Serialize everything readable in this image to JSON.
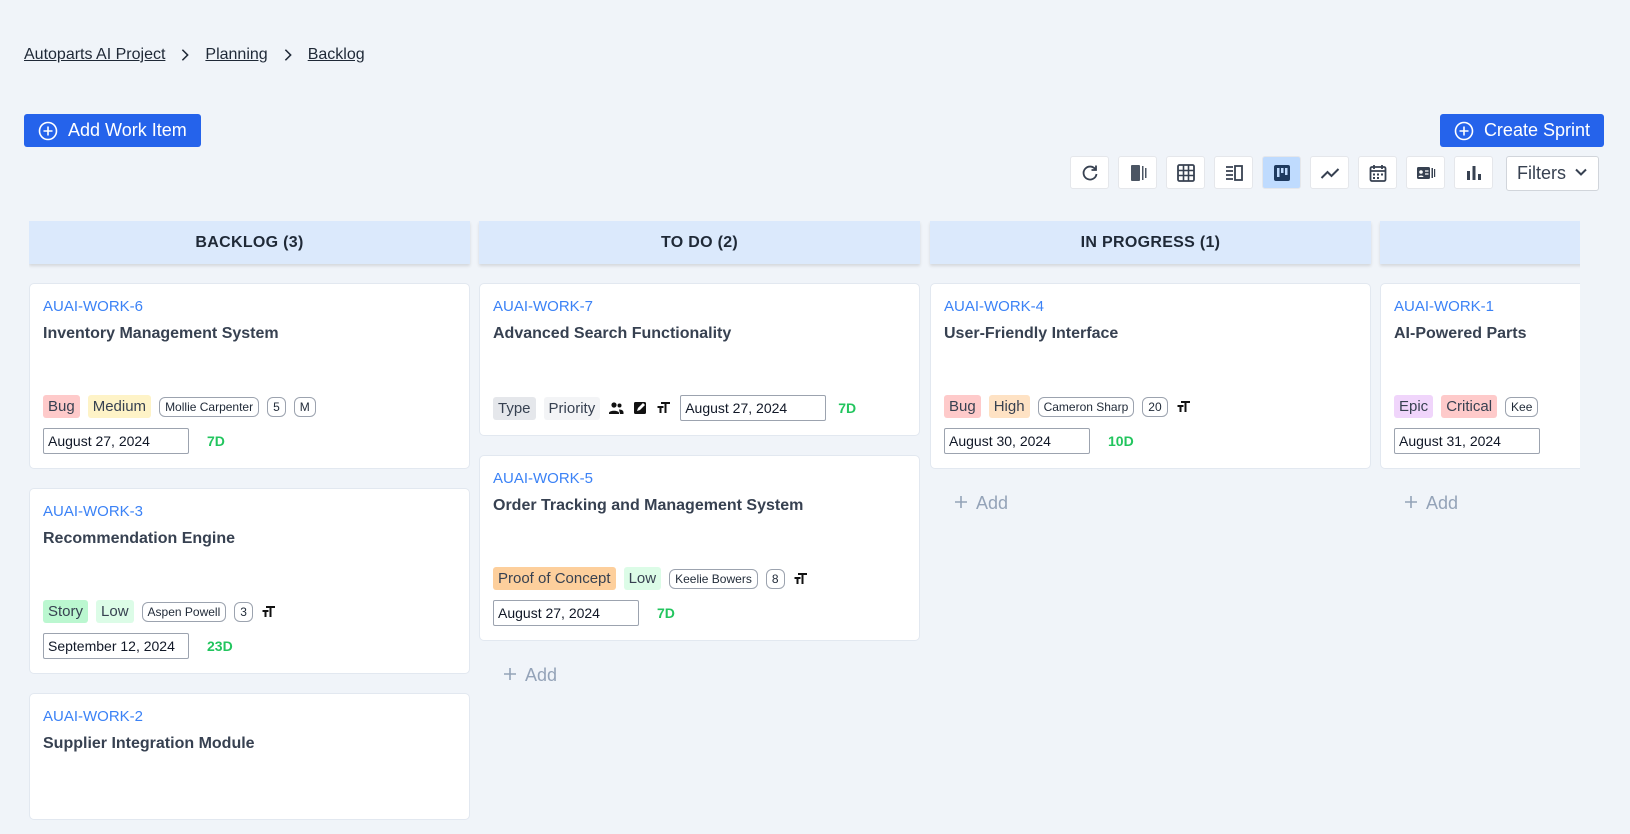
{
  "breadcrumb": [
    "Autoparts AI Project",
    "Planning",
    "Backlog"
  ],
  "actions": {
    "add_work_item": "Add Work Item",
    "create_sprint": "Create Sprint",
    "filters": "Filters",
    "add": "Add"
  },
  "toolbar_icons": [
    "refresh-icon",
    "sprint-view-icon",
    "grid-view-icon",
    "list-view-icon",
    "kanban-view-icon",
    "trend-view-icon",
    "calendar-view-icon",
    "card-view-icon",
    "chart-view-icon"
  ],
  "columns": [
    {
      "header": "BACKLOG (3)",
      "cards": [
        {
          "id": "AUAI-WORK-6",
          "title": "Inventory Management System",
          "type": "Bug",
          "priority": "Medium",
          "assignee": "Mollie Carpenter",
          "points": "5",
          "size": "M",
          "date": "August 27, 2024",
          "days": "7D"
        },
        {
          "id": "AUAI-WORK-3",
          "title": "Recommendation Engine",
          "type": "Story",
          "priority": "Low",
          "assignee": "Aspen Powell",
          "points": "3",
          "date": "September 12, 2024",
          "days": "23D"
        },
        {
          "id": "AUAI-WORK-2",
          "title": "Supplier Integration Module"
        }
      ]
    },
    {
      "header": "TO DO (2)",
      "cards": [
        {
          "id": "AUAI-WORK-7",
          "title": "Advanced Search Functionality",
          "type": "Type",
          "priority": "Priority",
          "date": "August 27, 2024",
          "days": "7D"
        },
        {
          "id": "AUAI-WORK-5",
          "title": "Order Tracking and Management System",
          "type": "Proof of Concept",
          "priority": "Low",
          "assignee": "Keelie Bowers",
          "points": "8",
          "date": "August 27, 2024",
          "days": "7D"
        }
      ]
    },
    {
      "header": "IN PROGRESS (1)",
      "cards": [
        {
          "id": "AUAI-WORK-4",
          "title": "User-Friendly Interface",
          "type": "Bug",
          "priority": "High",
          "assignee": "Cameron Sharp",
          "points": "20",
          "date": "August 30, 2024",
          "days": "10D"
        }
      ]
    },
    {
      "header": "",
      "cards": [
        {
          "id": "AUAI-WORK-1",
          "title": "AI-Powered Parts",
          "type": "Epic",
          "priority": "Critical",
          "assignee": "Kee",
          "date": "August 31, 2024"
        }
      ]
    }
  ]
}
